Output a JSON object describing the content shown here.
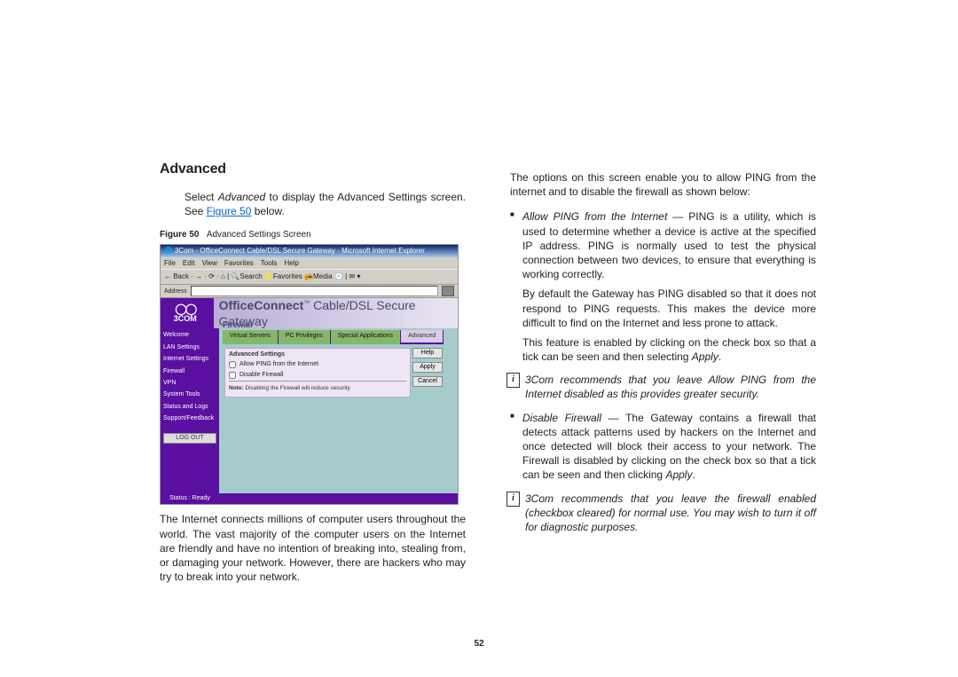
{
  "page_number": "52",
  "left": {
    "heading": "Advanced",
    "intro_pre": "Select ",
    "intro_em": "Advanced",
    "intro_post": " to display the Advanced Settings screen. See ",
    "intro_link": "Figure 50",
    "intro_after_link": " below.",
    "figure_label": "Figure 50",
    "figure_caption": "Advanced Settings Screen",
    "body_para": "The Internet connects millions of computer users throughout the world. The vast majority of the computer users on the Internet are friendly and have no intention of breaking into, stealing from, or damaging your network. However, there are hackers who may try to break into your network."
  },
  "screenshot": {
    "ie_title": "3Com - OfficeConnect Cable/DSL Secure Gateway - Microsoft Internet Explorer",
    "ie_menu": [
      "File",
      "Edit",
      "View",
      "Favorites",
      "Tools",
      "Help"
    ],
    "ie_toolbar": "← Back  ·  →  ·  ⟳  ·  ⌂  |  🔍Search  ⭐Favorites  📻Media  🕘  |  ✉  ▾",
    "addr_label": "Address",
    "logo_brand": "3COM",
    "app_title_bold": "OfficeConnect",
    "app_title_rest": " Cable/DSL Secure Gateway",
    "app_sub": "Firewall",
    "sidebar": [
      "Welcome",
      "LAN Settings",
      "Internet Settings",
      "Firewall",
      "VPN",
      "System Tools",
      "Status and Logs",
      "Support/Feedback"
    ],
    "logout": "LOG OUT",
    "tabs": [
      "Virtual Servers",
      "PC Privileges",
      "Special Applications",
      "Advanced"
    ],
    "panel_title": "Advanced Settings",
    "opt1": "Allow PING from the Internet",
    "opt2": "Disable Firewall",
    "note_bold": "Note:",
    "note_text": " Disabling the Firewall will reduce security",
    "btn_help": "Help",
    "btn_apply": "Apply",
    "btn_cancel": "Cancel",
    "status": "Status : Ready"
  },
  "right": {
    "intro": "The options on this screen enable you to allow PING from the internet and to disable the firewall as shown below:",
    "b1_em": "Allow PING from the Internet",
    "b1_dash": " — ",
    "b1_text": "PING is a utility, which is used to determine whether a device is active at the specified IP address. PING is normally used to test the physical connection between two devices, to ensure that everything is working correctly.",
    "b1_sub1": "By default the Gateway has PING disabled so that it does not respond to PING requests. This makes the device more difficult to find on the Internet and less prone to attack.",
    "b1_sub2_pre": "This feature is enabled by clicking on the check box so that a tick can be seen and then selecting ",
    "b1_sub2_em": "Apply",
    "b1_sub2_post": ".",
    "note1": "3Com recommends that you leave Allow PING from the Internet disabled as this provides greater security.",
    "b2_em": "Disable Firewall",
    "b2_dash": " — ",
    "b2_text_pre": "The Gateway contains a firewall that detects attack patterns used by hackers on the Internet and once detected will block their access to your network. The Firewall is disabled by clicking on the check box so that a tick can be seen and then clicking ",
    "b2_text_em": "Apply",
    "b2_text_post": ".",
    "note2": "3Com recommends that you leave the firewall enabled (checkbox cleared) for normal use. You may wish to turn it off for diagnostic purposes.",
    "info_glyph": "i"
  }
}
